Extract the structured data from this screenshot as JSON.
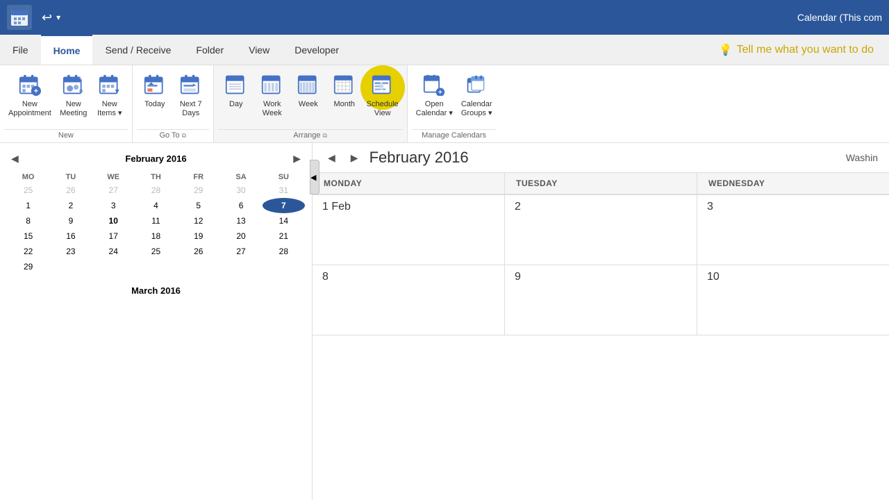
{
  "titleBar": {
    "title": "Calendar (This com",
    "appIcon": "calendar-app-icon"
  },
  "menuBar": {
    "items": [
      {
        "label": "File",
        "active": false
      },
      {
        "label": "Home",
        "active": true
      },
      {
        "label": "Send / Receive",
        "active": false
      },
      {
        "label": "Folder",
        "active": false
      },
      {
        "label": "View",
        "active": false
      },
      {
        "label": "Developer",
        "active": false
      }
    ],
    "tell": "Tell me what you want to do"
  },
  "ribbon": {
    "groups": [
      {
        "name": "New",
        "label": "New",
        "buttons": [
          {
            "id": "new-appointment",
            "label": "New\nAppointment",
            "lines": [
              "New",
              "Appointment"
            ]
          },
          {
            "id": "new-meeting",
            "label": "New\nMeeting",
            "lines": [
              "New",
              "Meeting"
            ]
          },
          {
            "id": "new-items",
            "label": "New\nItems",
            "lines": [
              "New",
              "Items"
            ],
            "dropdown": true
          }
        ]
      },
      {
        "name": "Go To",
        "label": "Go To",
        "buttons": [
          {
            "id": "today",
            "label": "Today",
            "lines": [
              "Today"
            ]
          },
          {
            "id": "next-7-days",
            "label": "Next 7\nDays",
            "lines": [
              "Next 7",
              "Days"
            ]
          }
        ]
      },
      {
        "name": "Arrange",
        "label": "Arrange",
        "buttons": [
          {
            "id": "day",
            "label": "Day",
            "lines": [
              "Day"
            ]
          },
          {
            "id": "work-week",
            "label": "Work\nWeek",
            "lines": [
              "Work",
              "Week"
            ]
          },
          {
            "id": "week",
            "label": "Week",
            "lines": [
              "Week"
            ]
          },
          {
            "id": "month",
            "label": "Month",
            "lines": [
              "Month"
            ]
          },
          {
            "id": "schedule-view",
            "label": "Schedule\nView",
            "lines": [
              "Schedule",
              "View"
            ],
            "highlighted": true
          }
        ]
      },
      {
        "name": "Manage Calendars",
        "label": "Manage Calendars",
        "buttons": [
          {
            "id": "open-calendar",
            "label": "Open\nCalendar",
            "lines": [
              "Open",
              "Calendar"
            ],
            "dropdown": true
          },
          {
            "id": "calendar-groups",
            "label": "Calendar\nGroups",
            "lines": [
              "Calendar",
              "Groups"
            ],
            "dropdown": true
          }
        ]
      }
    ]
  },
  "sidebar": {
    "calendars": [
      {
        "month": "February 2016",
        "weekHeaders": [
          "MO",
          "TU",
          "WE",
          "TH",
          "FR",
          "SA",
          "SU"
        ],
        "weeks": [
          [
            {
              "day": "25",
              "otherMonth": true
            },
            {
              "day": "26",
              "otherMonth": true
            },
            {
              "day": "27",
              "otherMonth": true
            },
            {
              "day": "28",
              "otherMonth": true
            },
            {
              "day": "29",
              "otherMonth": true
            },
            {
              "day": "30",
              "otherMonth": true
            },
            {
              "day": "31",
              "otherMonth": true
            }
          ],
          [
            {
              "day": "1"
            },
            {
              "day": "2"
            },
            {
              "day": "3"
            },
            {
              "day": "4"
            },
            {
              "day": "5"
            },
            {
              "day": "6"
            },
            {
              "day": "7",
              "today": true
            }
          ],
          [
            {
              "day": "8"
            },
            {
              "day": "9"
            },
            {
              "day": "10",
              "bold": true
            },
            {
              "day": "11"
            },
            {
              "day": "12"
            },
            {
              "day": "13"
            },
            {
              "day": "14"
            }
          ],
          [
            {
              "day": "15"
            },
            {
              "day": "16"
            },
            {
              "day": "17"
            },
            {
              "day": "18"
            },
            {
              "day": "19"
            },
            {
              "day": "20"
            },
            {
              "day": "21"
            }
          ],
          [
            {
              "day": "22"
            },
            {
              "day": "23"
            },
            {
              "day": "24"
            },
            {
              "day": "25"
            },
            {
              "day": "26"
            },
            {
              "day": "27"
            },
            {
              "day": "28"
            }
          ],
          [
            {
              "day": "29"
            }
          ]
        ]
      },
      {
        "month": "March 2016"
      }
    ]
  },
  "calMain": {
    "navPrev": "◀",
    "navNext": "▶",
    "title": "February 2016",
    "location": "Washin",
    "columnHeaders": [
      "MONDAY",
      "TUESDAY",
      "WEDNESDAY"
    ],
    "weeks": [
      {
        "cells": [
          {
            "dateNum": "1 Feb",
            "label": ""
          },
          {
            "dateNum": "2",
            "label": ""
          },
          {
            "dateNum": "3",
            "label": ""
          }
        ]
      },
      {
        "cells": [
          {
            "dateNum": "8",
            "label": ""
          },
          {
            "dateNum": "9",
            "label": ""
          },
          {
            "dateNum": "10",
            "label": ""
          }
        ]
      }
    ]
  }
}
